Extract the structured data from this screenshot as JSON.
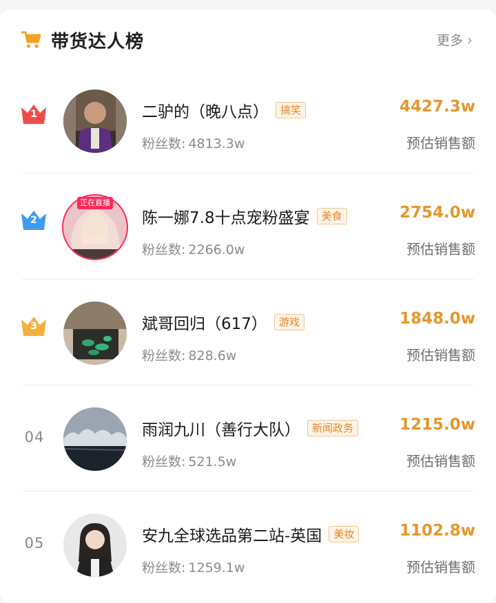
{
  "header": {
    "title": "带货达人榜",
    "more_label": "更多",
    "accent_color": "#f2a227"
  },
  "rows": [
    {
      "rank": "1",
      "rank_style": "crown",
      "crown_color": "#ef4b4b",
      "name": "二驴的（晚八点）",
      "tag": "搞笑",
      "fans_label": "粉丝数:",
      "fans_value": "4813.3w",
      "amount": "4427.3w",
      "amount_label": "预估销售额",
      "live": false
    },
    {
      "rank": "2",
      "rank_style": "crown",
      "crown_color": "#3d9bf0",
      "name": "陈一娜7.8十点宠粉盛宴",
      "tag": "美食",
      "fans_label": "粉丝数:",
      "fans_value": "2266.0w",
      "amount": "2754.0w",
      "amount_label": "预估销售额",
      "live": true,
      "live_label": "正在直播"
    },
    {
      "rank": "3",
      "rank_style": "crown",
      "crown_color": "#f5b03c",
      "name": "斌哥回归（617）",
      "tag": "游戏",
      "fans_label": "粉丝数:",
      "fans_value": "828.6w",
      "amount": "1848.0w",
      "amount_label": "预估销售额",
      "live": false
    },
    {
      "rank": "04",
      "rank_style": "number",
      "name": "雨润九川（善行大队）",
      "tag": "新闻政务",
      "fans_label": "粉丝数:",
      "fans_value": "521.5w",
      "amount": "1215.0w",
      "amount_label": "预估销售额",
      "live": false
    },
    {
      "rank": "05",
      "rank_style": "number",
      "name": "安九全球选品第二站-英国",
      "tag": "美妆",
      "fans_label": "粉丝数:",
      "fans_value": "1259.1w",
      "amount": "1102.8w",
      "amount_label": "预估销售额",
      "live": false
    }
  ]
}
